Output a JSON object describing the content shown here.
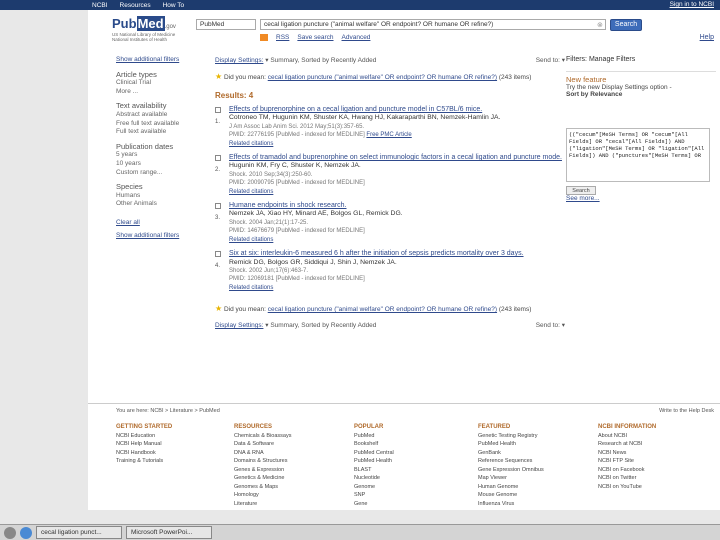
{
  "topbar": {
    "ncbi": "NCBI",
    "resources": "Resources",
    "howto": "How To",
    "signin": "Sign in to NCBI"
  },
  "header": {
    "logo_pub": "Pub",
    "logo_med": "Med",
    "logo_gov": ".gov",
    "logo_sub1": "US National Library of Medicine",
    "logo_sub2": "National Institutes of Health",
    "db": "PubMed",
    "query": "cecal ligation puncture (\"animal welfare\" OR endpoint? OR humane OR refine?)",
    "search": "Search",
    "rss": "RSS",
    "save": "Save search",
    "advanced": "Advanced",
    "help": "Help"
  },
  "sidebar": {
    "show_filters": "Show additional filters",
    "article_types": "Article types",
    "clinical_trial": "Clinical Trial",
    "more": "More ...",
    "text_avail": "Text availability",
    "abstract": "Abstract available",
    "free": "Free full text available",
    "full": "Full text available",
    "pubdates": "Publication dates",
    "y5": "5 years",
    "y10": "10 years",
    "custom": "Custom range...",
    "species": "Species",
    "humans": "Humans",
    "other": "Other Animals",
    "clear": "Clear all",
    "show2": "Show additional filters"
  },
  "main": {
    "display": "Display Settings:",
    "summary": "Summary, Sorted by Recently Added",
    "sendto": "Send to:",
    "dym_prefix": "Did you mean:",
    "dym_link": "cecal ligation puncture (\"animal welfare\" OR endpoint? OR humane OR refine?)",
    "dym_count": "(243 items)",
    "results": "Results: 4",
    "items": [
      {
        "num": "1.",
        "title": "Effects of buprenorphine on a cecal ligation and puncture model in C57BL/6 mice.",
        "auth": "Cotroneo TM, Hugunin KM, Shuster KA, Hwang HJ, Kakaraparthi BN, Nemzek-Hamlin JA.",
        "meta": "J Am Assoc Lab Anim Sci. 2012 May;51(3):357-65.",
        "meta2": "PMID: 22776195 [PubMed - indexed for MEDLINE]",
        "free": "Free PMC Article",
        "rel": "Related citations"
      },
      {
        "num": "2.",
        "title": "Effects of tramadol and buprenorphine on select immunologic factors in a cecal ligation and puncture mode.",
        "auth": "Hugunin KM, Fry C, Shuster K, Nemzek JA.",
        "meta": "Shock. 2010 Sep;34(3):250-60.",
        "meta2": "PMID: 20090795 [PubMed - indexed for MEDLINE]",
        "free": "",
        "rel": "Related citations"
      },
      {
        "num": "3.",
        "title": "Humane endpoints in shock research.",
        "auth": "Nemzek JA, Xiao HY, Minard AE, Bolgos GL, Remick DG.",
        "meta": "Shock. 2004 Jan;21(1):17-25.",
        "meta2": "PMID: 14676679 [PubMed - indexed for MEDLINE]",
        "free": "",
        "rel": "Related citations"
      },
      {
        "num": "4.",
        "title": "Six at six: interleukin-6 measured 6 h after the initiation of sepsis predicts mortality over 3 days.",
        "auth": "Remick DG, Bolgos GR, Siddiqui J, Shin J, Nemzek JA.",
        "meta": "Shock. 2002 Jun;17(6):463-7.",
        "meta2": "PMID: 12069181 [PubMed - indexed for MEDLINE]",
        "free": "",
        "rel": "Related citations"
      }
    ]
  },
  "right": {
    "filters": "Filters: Manage Filters",
    "newfeat": "New feature",
    "try": "Try the new Display Settings option -",
    "sort": "Sort by Relevance",
    "details": "((\"cecum\"[MeSH Terms] OR \"cecum\"[All Fields] OR \"cecal\"[All Fields]) AND (\"ligation\"[MeSH Terms] OR \"ligation\"[All Fields]) AND (\"punctures\"[MeSH Terms] OR",
    "btn": "Search",
    "seemore": "See more..."
  },
  "footer": {
    "you": "You are here: NCBI > Literature > PubMed",
    "helpdesk": "Write to the Help Desk",
    "cols": [
      {
        "h": "GETTING STARTED",
        "items": [
          "NCBI Education",
          "NCBI Help Manual",
          "NCBI Handbook",
          "Training & Tutorials"
        ]
      },
      {
        "h": "RESOURCES",
        "items": [
          "Chemicals & Bioassays",
          "Data & Software",
          "DNA & RNA",
          "Domains & Structures",
          "Genes & Expression",
          "Genetics & Medicine",
          "Genomes & Maps",
          "Homology",
          "Literature"
        ]
      },
      {
        "h": "POPULAR",
        "items": [
          "PubMed",
          "Bookshelf",
          "PubMed Central",
          "PubMed Health",
          "BLAST",
          "Nucleotide",
          "Genome",
          "SNP",
          "Gene"
        ]
      },
      {
        "h": "FEATURED",
        "items": [
          "Genetic Testing Registry",
          "PubMed Health",
          "GenBank",
          "Reference Sequences",
          "Gene Expression Omnibus",
          "Map Viewer",
          "Human Genome",
          "Mouse Genome",
          "Influenza Virus"
        ]
      },
      {
        "h": "NCBI INFORMATION",
        "items": [
          "About NCBI",
          "Research at NCBI",
          "NCBI News",
          "NCBI FTP Site",
          "NCBI on Facebook",
          "NCBI on Twitter",
          "NCBI on YouTube"
        ]
      }
    ]
  },
  "taskbar": {
    "tab1": "cecal ligation punct...",
    "tab2": "Microsoft PowerPoi..."
  }
}
